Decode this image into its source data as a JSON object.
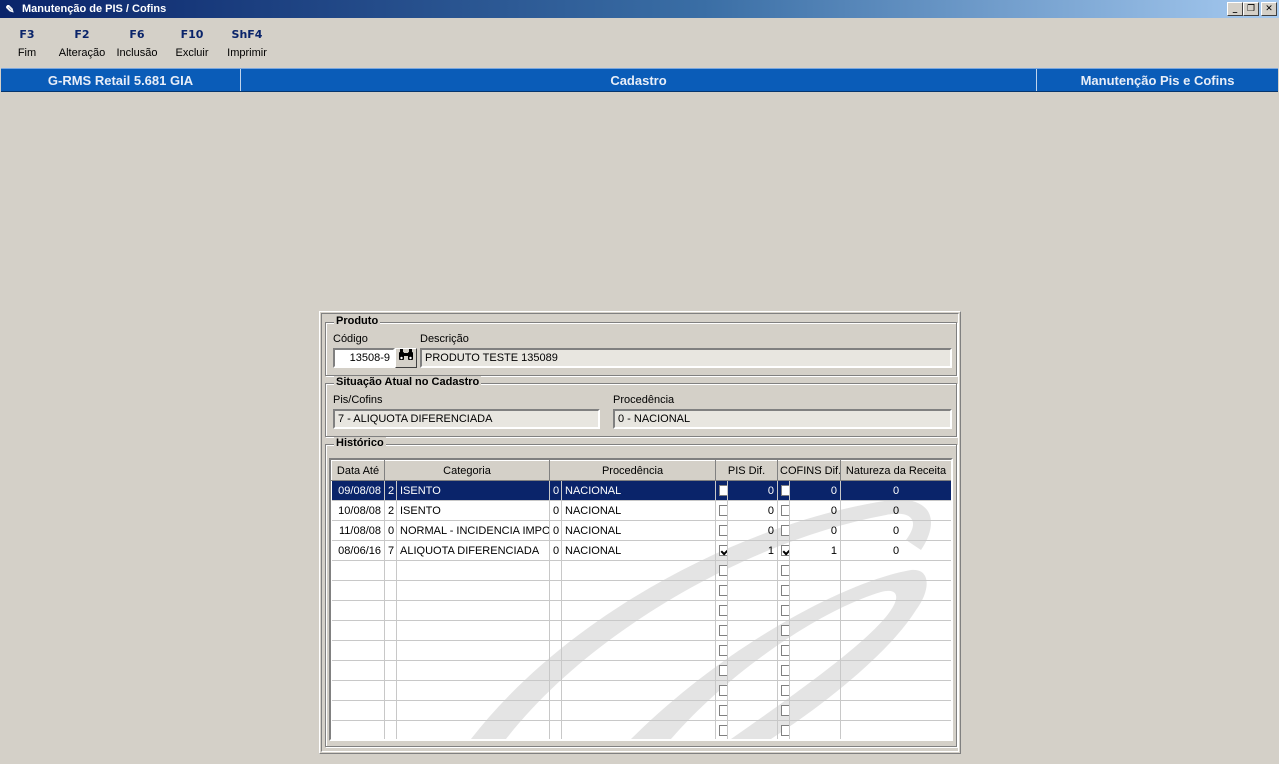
{
  "window": {
    "title": "Manutenção de PIS / Cofins"
  },
  "toolbar": [
    {
      "key": "F3",
      "label": "Fim"
    },
    {
      "key": "F2",
      "label": "Alteração"
    },
    {
      "key": "F6",
      "label": "Inclusão"
    },
    {
      "key": "F10",
      "label": "Excluir"
    },
    {
      "key": "ShF4",
      "label": "Imprimir"
    }
  ],
  "status": {
    "app": "G-RMS Retail 5.681 GIA",
    "module": "Cadastro",
    "screen": "Manutenção Pis e Cofins"
  },
  "produto": {
    "legend": "Produto",
    "codigo_label": "Código",
    "codigo_value": "13508-9",
    "descricao_label": "Descrição",
    "descricao_value": "PRODUTO TESTE 135089"
  },
  "situacao": {
    "legend": "Situação Atual no Cadastro",
    "pis_label": "Pis/Cofins",
    "pis_value": "7 - ALIQUOTA DIFERENCIADA",
    "proc_label": "Procedência",
    "proc_value": "0 - NACIONAL"
  },
  "historico": {
    "legend": "Histórico",
    "columns": [
      "Data Até",
      "Categoria",
      "Procedência",
      "PIS Dif.",
      "COFINS Dif.",
      "Natureza da Receita"
    ],
    "rows": [
      {
        "data": "09/08/08",
        "cat_code": "2",
        "cat_desc": "ISENTO",
        "proc_code": "0",
        "proc_desc": "NACIONAL",
        "pis_chk": false,
        "pis_val": "0",
        "cof_chk": false,
        "cof_val": "0",
        "natureza": "0"
      },
      {
        "data": "10/08/08",
        "cat_code": "2",
        "cat_desc": "ISENTO",
        "proc_code": "0",
        "proc_desc": "NACIONAL",
        "pis_chk": false,
        "pis_val": "0",
        "cof_chk": false,
        "cof_val": "0",
        "natureza": "0"
      },
      {
        "data": "11/08/08",
        "cat_code": "0",
        "cat_desc": "NORMAL - INCIDENCIA IMPOST",
        "proc_code": "0",
        "proc_desc": "NACIONAL",
        "pis_chk": false,
        "pis_val": "0",
        "cof_chk": false,
        "cof_val": "0",
        "natureza": "0"
      },
      {
        "data": "08/06/16",
        "cat_code": "7",
        "cat_desc": "ALIQUOTA DIFERENCIADA",
        "proc_code": "0",
        "proc_desc": "NACIONAL",
        "pis_chk": true,
        "pis_val": "1",
        "cof_chk": true,
        "cof_val": "1",
        "natureza": "0"
      }
    ],
    "selected_row": 0
  }
}
